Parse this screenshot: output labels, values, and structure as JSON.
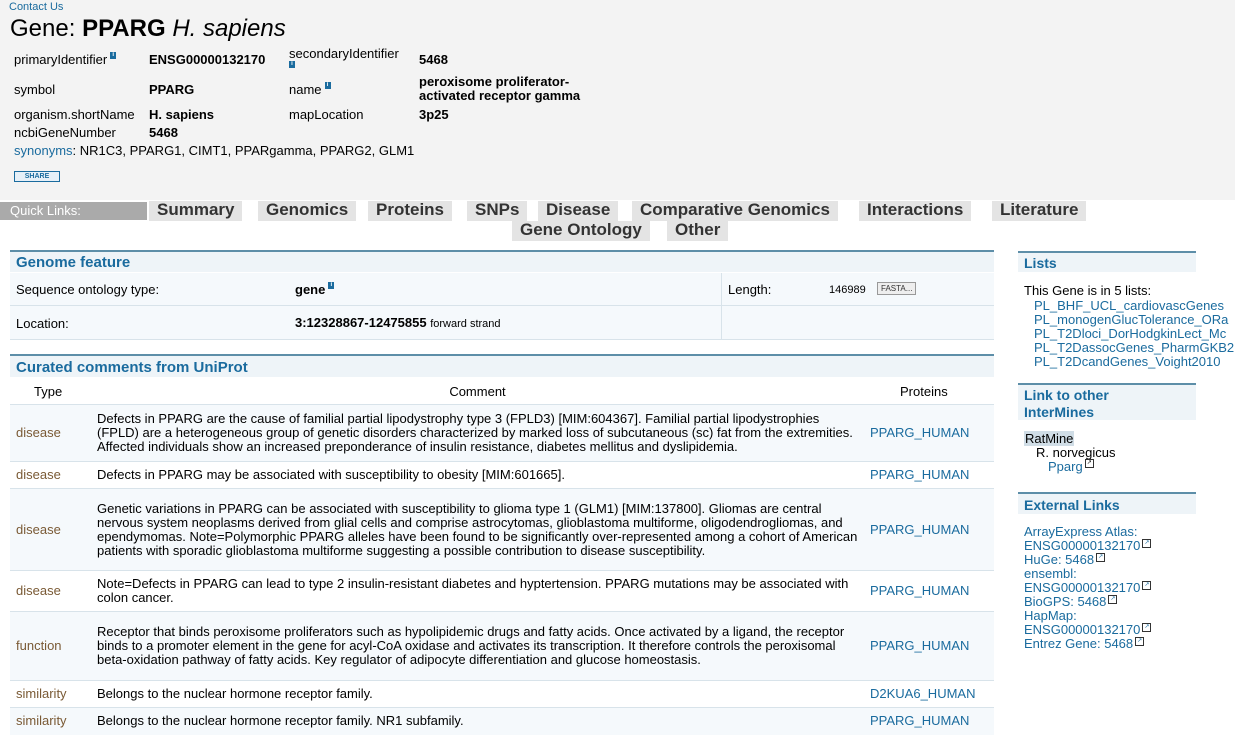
{
  "contact_link": "Contact Us",
  "title": {
    "prefix": "Gene:",
    "symbol": "PPARG",
    "organism": "H. sapiens"
  },
  "fields": {
    "primaryIdentifier": {
      "label": "primaryIdentifier",
      "value": "ENSG00000132170"
    },
    "secondaryIdentifier": {
      "label": "secondaryIdentifier",
      "value": "5468"
    },
    "symbol": {
      "label": "symbol",
      "value": "PPARG"
    },
    "name": {
      "label": "name",
      "value_line1": "peroxisome proliferator-",
      "value_line2": "activated receptor gamma"
    },
    "organism": {
      "label": "organism.shortName",
      "value": "H. sapiens"
    },
    "mapLocation": {
      "label": "mapLocation",
      "value": "3p25"
    },
    "ncbiGeneNumber": {
      "label": "ncbiGeneNumber",
      "value": "5468"
    }
  },
  "synonyms": {
    "label": "synonyms",
    "sep": ":",
    "value": "NR1C3, PPARG1, CIMT1, PPARgamma, PPARG2, GLM1"
  },
  "share_label": "SHARE",
  "quick_links": {
    "label": "Quick Links:",
    "tabs": [
      "Summary",
      "Genomics",
      "Proteins",
      "SNPs",
      "Disease",
      "Comparative Genomics",
      "Interactions",
      "Literature",
      "Gene Ontology",
      "Other"
    ]
  },
  "genome_feature": {
    "title": "Genome feature",
    "so_label": "Sequence ontology type:",
    "so_value": "gene",
    "length_label": "Length:",
    "length_value": "146989",
    "fasta_label": "FASTA...",
    "location_label": "Location:",
    "location_value": "3:12328867-12475855",
    "strand": "forward strand"
  },
  "uniprot": {
    "title": "Curated comments from UniProt",
    "headers": [
      "Type",
      "Comment",
      "Proteins"
    ],
    "rows": [
      {
        "type": "disease",
        "comment": "Defects in PPARG are the cause of familial partial lipodystrophy type 3 (FPLD3) [MIM:604367]. Familial partial lipodystrophies (FPLD) are a heterogeneous group of genetic disorders characterized by marked loss of subcutaneous (sc) fat from the extremities. Affected individuals show an increased preponderance of insulin resistance, diabetes mellitus and dyslipidemia.",
        "protein": "PPARG_HUMAN"
      },
      {
        "type": "disease",
        "comment": "Defects in PPARG may be associated with susceptibility to obesity [MIM:601665].",
        "protein": "PPARG_HUMAN"
      },
      {
        "type": "disease",
        "comment": "Genetic variations in PPARG can be associated with susceptibility to glioma type 1 (GLM1) [MIM:137800]. Gliomas are central nervous system neoplasms derived from glial cells and comprise astrocytomas, glioblastoma multiforme, oligodendrogliomas, and ependymomas. Note=Polymorphic PPARG alleles have been found to be significantly over-represented among a cohort of American patients with sporadic glioblastoma multiforme suggesting a possible contribution to disease susceptibility.",
        "protein": "PPARG_HUMAN"
      },
      {
        "type": "disease",
        "comment": "Note=Defects in PPARG can lead to type 2 insulin-resistant diabetes and hyptertension. PPARG mutations may be associated with colon cancer.",
        "protein": "PPARG_HUMAN"
      },
      {
        "type": "function",
        "comment": "Receptor that binds peroxisome proliferators such as hypolipidemic drugs and fatty acids. Once activated by a ligand, the receptor binds to a promoter element in the gene for acyl-CoA oxidase and activates its transcription. It therefore controls the peroxisomal beta-oxidation pathway of fatty acids. Key regulator of adipocyte differentiation and glucose homeostasis.",
        "protein": "PPARG_HUMAN"
      },
      {
        "type": "similarity",
        "comment": "Belongs to the nuclear hormone receptor family.",
        "protein": "D2KUA6_HUMAN"
      },
      {
        "type": "similarity",
        "comment": "Belongs to the nuclear hormone receptor family. NR1 subfamily.",
        "protein": "PPARG_HUMAN"
      }
    ]
  },
  "lists": {
    "title": "Lists",
    "intro": "This Gene is in 5 lists:",
    "items": [
      "PL_BHF_UCL_cardiovascGenes",
      "PL_monogenGlucTolerance_ORa",
      "PL_T2Dloci_DorHodgkinLect_Mc",
      "PL_T2DassocGenes_PharmGKB2",
      "PL_T2DcandGenes_Voight2010"
    ]
  },
  "intermines": {
    "title_line1": "Link to other",
    "title_line2": "InterMines",
    "mine": "RatMine",
    "organism": "R. norvegicus",
    "gene": "Pparg"
  },
  "external": {
    "title": "External Links",
    "lines": [
      "ArrayExpress Atlas:",
      "ENSG00000132170",
      "HuGe: 5468",
      "ensembl:",
      "ENSG00000132170",
      "BioGPS: 5468",
      "HapMap:",
      "ENSG00000132170",
      "Entrez Gene: 5468"
    ]
  },
  "colors": {
    "link": "#1a6b9e",
    "type_text": "#7a5a35",
    "tab_bg": "#e4e4e4",
    "quick_bg": "#aaaaaa"
  }
}
